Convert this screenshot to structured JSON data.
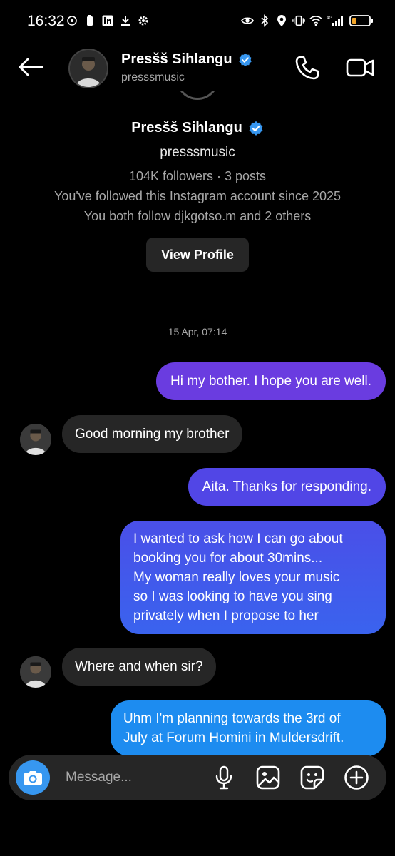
{
  "status_bar": {
    "time": "16:32"
  },
  "header": {
    "name": "Presšš Sihlangu",
    "username": "presssmusic"
  },
  "profile_card": {
    "name": "Presšš Sihlangu",
    "username": "presssmusic",
    "followers": "104K followers · 3 posts",
    "followed_since": "You've followed this Instagram account since 2025",
    "mutual": "You both follow djkgotso.m and 2 others",
    "view_profile_label": "View Profile"
  },
  "thread": {
    "timestamp": "15 Apr, 07:14",
    "messages": [
      {
        "direction": "outgoing",
        "text": "Hi my bother. I hope you are well."
      },
      {
        "direction": "incoming",
        "text": "Good morning my brother"
      },
      {
        "direction": "outgoing",
        "text": "Aita. Thanks for responding."
      },
      {
        "direction": "outgoing",
        "lines": [
          "I wanted to ask how I can go about",
          "booking you for about 30mins...",
          "My woman really loves your music",
          "so I was looking to have you sing",
          "privately when I propose to her"
        ]
      },
      {
        "direction": "incoming",
        "text": "Where and when sir?"
      },
      {
        "direction": "outgoing",
        "lines": [
          "Uhm I'm planning towards the 3rd of",
          "July at Forum Homini in Muldersdrift."
        ]
      }
    ]
  },
  "composer": {
    "placeholder": "Message..."
  },
  "colors": {
    "background": "#000000",
    "bubble_incoming": "#262626",
    "bubble_outgoing_purple": "#6a3ce0",
    "bubble_outgoing_blue": "#1d8cf0",
    "accent_blue": "#3797f0",
    "verified_blue": "#3797f0"
  },
  "icons": {
    "back": "arrow-left-icon",
    "call": "phone-icon",
    "video": "video-camera-icon",
    "verified": "verified-badge-icon",
    "camera": "camera-icon",
    "mic": "microphone-icon",
    "gallery": "image-icon",
    "sticker": "sticker-icon",
    "add": "plus-circle-icon"
  }
}
